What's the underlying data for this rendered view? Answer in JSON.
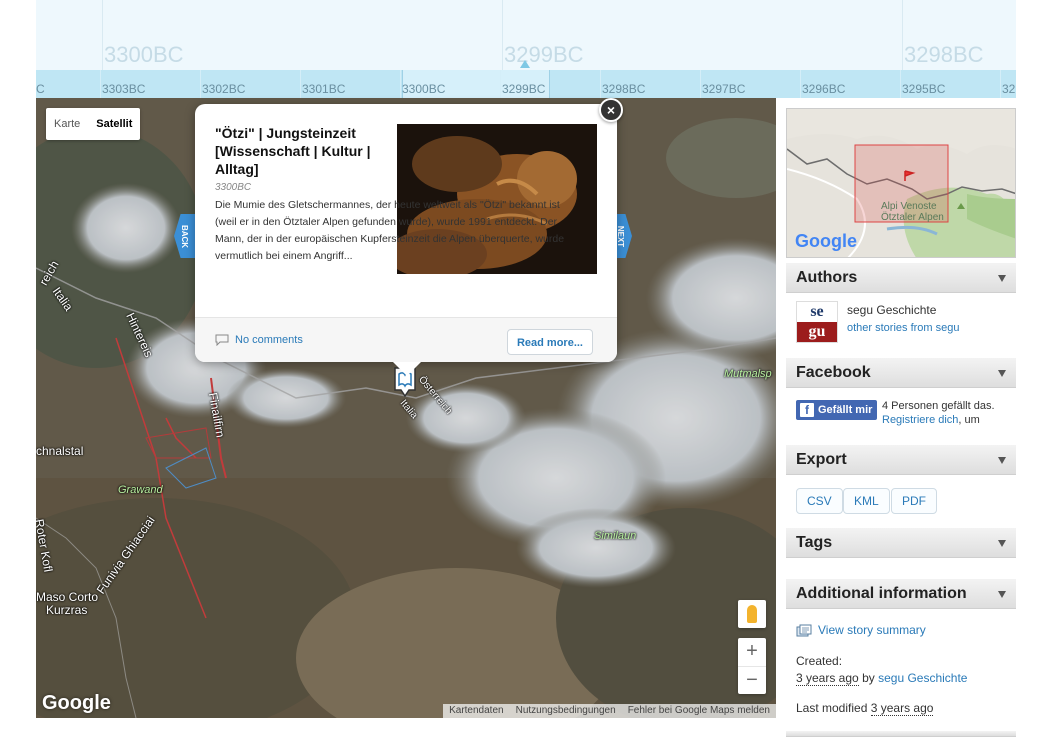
{
  "timeline": {
    "major": [
      "3300BC",
      "3299BC",
      "3298BC"
    ],
    "minor": [
      "C",
      "3303BC",
      "3302BC",
      "3301BC",
      "3300BC",
      "3299BC",
      "3298BC",
      "3297BC",
      "3296BC",
      "3295BC",
      "32"
    ]
  },
  "map": {
    "type_buttons": [
      "Karte",
      "Satellit"
    ],
    "selected_type": "Satellit",
    "back_label": "BACK",
    "next_label": "NEXT",
    "places": {
      "reich": "reich",
      "italia": "Italia",
      "hintereis": "Hintereis",
      "finailfirn": "Finailfirn",
      "schnalstal": "chnalstal",
      "grawand": "Grawand",
      "roter_kofl": "Roter Kofl",
      "funivia": "Funivia Ghiacciai",
      "maso_corto": "Maso Corto",
      "kurzras": "Kurzras",
      "mutmalsp": "Mutmalsp",
      "similaun": "Similaun",
      "oesterreich": "Österreich",
      "italia2": "Italia"
    },
    "zoom_in": "+",
    "zoom_out": "−",
    "logo": "Google",
    "attribution": [
      "Kartendaten",
      "Nutzungsbedingungen",
      "Fehler bei Google Maps melden"
    ]
  },
  "popup": {
    "title": "\"Ötzi\" | Jungsteinzeit [Wissenschaft | Kultur | Alltag]",
    "date": "3300BC",
    "description": "Die Mumie des Gletschermannes, der heute weltweit als \"Ötzi\" bekannt ist (weil er in den Ötztaler Alpen gefunden wurde), wurde 1991 entdeckt. Der Mann, der in der europäischen Kupfersteinzeit die Alpen überquerte, wurde vermutlich bei einem Angriff...",
    "comments": "No comments",
    "read_more": "Read more...",
    "close": "×"
  },
  "sidebar": {
    "minimap": {
      "logo": "Google",
      "label_line1": "Alpi Venoste",
      "label_line2": "Ötztaler Alpen"
    },
    "authors": {
      "heading": "Authors",
      "avatar_top": "se",
      "avatar_bottom": "gu",
      "name": "segu Geschichte",
      "other": "other stories from segu"
    },
    "facebook": {
      "heading": "Facebook",
      "button": "Gefällt mir",
      "count_text": "4 Personen gefällt das.",
      "register": "Registriere dich",
      "register_suffix": ", um"
    },
    "export": {
      "heading": "Export",
      "buttons": [
        "CSV",
        "KML",
        "PDF"
      ]
    },
    "tags": {
      "heading": "Tags"
    },
    "additional": {
      "heading": "Additional information",
      "summary_link": "View story summary",
      "created_label": "Created:",
      "created_ago": "3 years ago",
      "by": "by",
      "author": "segu Geschichte",
      "modified_label": "Last modified",
      "modified_ago": "3 years ago"
    }
  },
  "colors": {
    "link": "#2a7ab8",
    "timeline_band": "#bfe6f4",
    "nav_tab": "#3b8fd6",
    "facebook": "#4267b2"
  }
}
